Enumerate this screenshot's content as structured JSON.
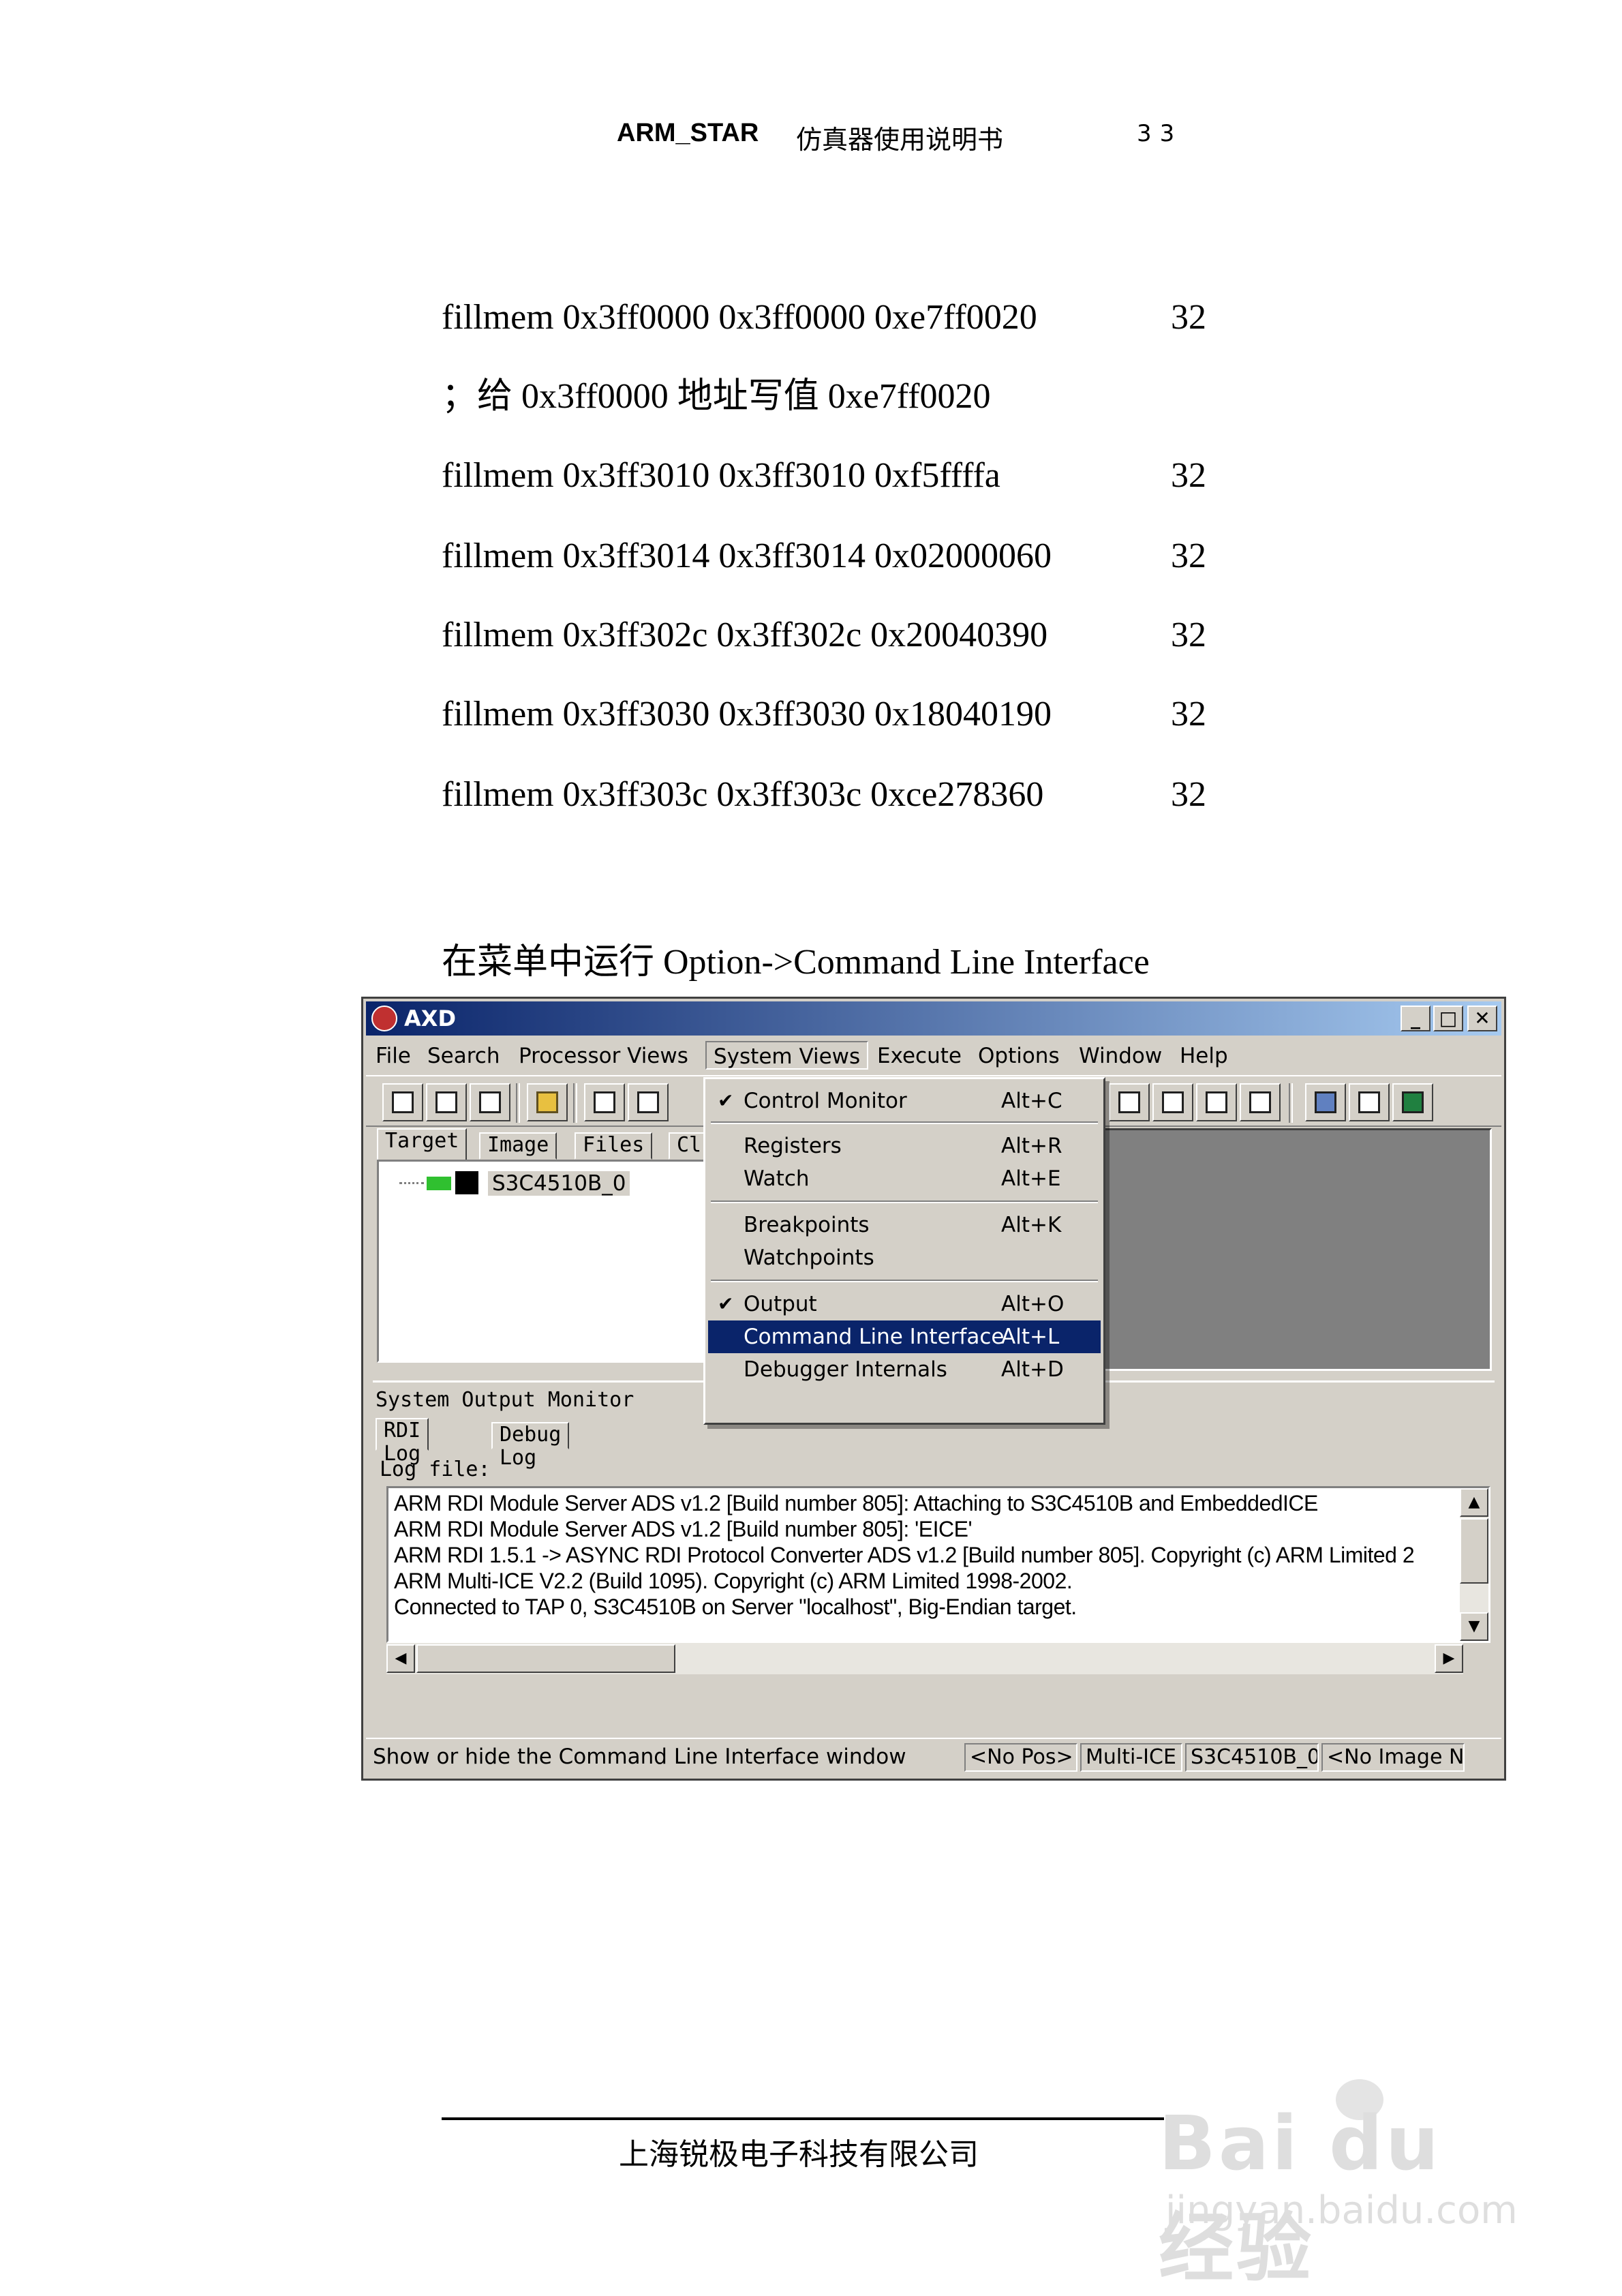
{
  "header": {
    "title": "ARM_STAR",
    "subtitle": "仿真器使用说明书",
    "page": "33"
  },
  "commands": [
    {
      "text": "fillmem 0x3ff0000 0x3ff0000 0xe7ff0020",
      "width": "32"
    },
    {
      "text": "；给 0x3ff0000 地址写值 0xe7ff0020",
      "width": ""
    },
    {
      "text": "fillmem 0x3ff3010 0x3ff3010 0xf5ffffa",
      "width": "32"
    },
    {
      "text": "fillmem 0x3ff3014 0x3ff3014 0x02000060",
      "width": "32"
    },
    {
      "text": "fillmem 0x3ff302c 0x3ff302c 0x20040390",
      "width": "32"
    },
    {
      "text": "fillmem 0x3ff3030 0x3ff3030 0x18040190",
      "width": "32"
    },
    {
      "text": "fillmem 0x3ff303c 0x3ff303c 0xce278360",
      "width": "32"
    }
  ],
  "caption": "在菜单中运行  Option->Command Line Interface",
  "window": {
    "title": "AXD",
    "controls": {
      "minimize": "_",
      "maximize": "□",
      "close": "✕"
    },
    "menu": [
      "File",
      "Search",
      "Processor Views",
      "System Views",
      "Execute",
      "Options",
      "Window",
      "Help"
    ],
    "left_tabs": [
      "Target",
      "Image",
      "Files",
      "Cl"
    ],
    "tree_node": "S3C4510B_0",
    "panel_title": "System Output Monitor",
    "log_tabs": [
      "RDI Log",
      "Debug Log"
    ],
    "log_file_label": "Log file:",
    "log_lines": [
      "ARM RDI Module Server ADS v1.2 [Build number 805]: Attaching to S3C4510B and EmbeddedICE",
      "ARM RDI Module Server ADS v1.2 [Build number 805]: 'EICE'",
      "ARM RDI 1.5.1 -> ASYNC RDI Protocol Converter ADS v1.2 [Build number 805]. Copyright (c) ARM Limited 2",
      "ARM Multi-ICE V2.2 (Build 1095). Copyright (c) ARM Limited 1998-2002.",
      "Connected to TAP 0, S3C4510B on Server \"localhost\", Big-Endian target."
    ],
    "status": {
      "message": "Show or hide the Command Line Interface window",
      "cells": [
        "<No Pos>",
        "Multi-ICE",
        "S3C4510B_0",
        "<No Image N"
      ]
    },
    "dropdown": [
      {
        "label": "Control Monitor",
        "accel": "Alt+C",
        "checked": "✔"
      },
      {
        "label": "Registers",
        "accel": "Alt+R"
      },
      {
        "label": "Watch",
        "accel": "Alt+E"
      },
      {
        "label": "Breakpoints",
        "accel": "Alt+K"
      },
      {
        "label": "Watchpoints",
        "accel": ""
      },
      {
        "label": "Output",
        "accel": "Alt+O",
        "checked": "✔"
      },
      {
        "label": "Command Line Interface",
        "accel": "Alt+L"
      },
      {
        "label": "Debugger Internals",
        "accel": "Alt+D"
      }
    ]
  },
  "footer": "上海锐极电子科技有限公司",
  "watermark": {
    "brand": "Bai du 经验",
    "url": "jingyan.baidu.com"
  }
}
